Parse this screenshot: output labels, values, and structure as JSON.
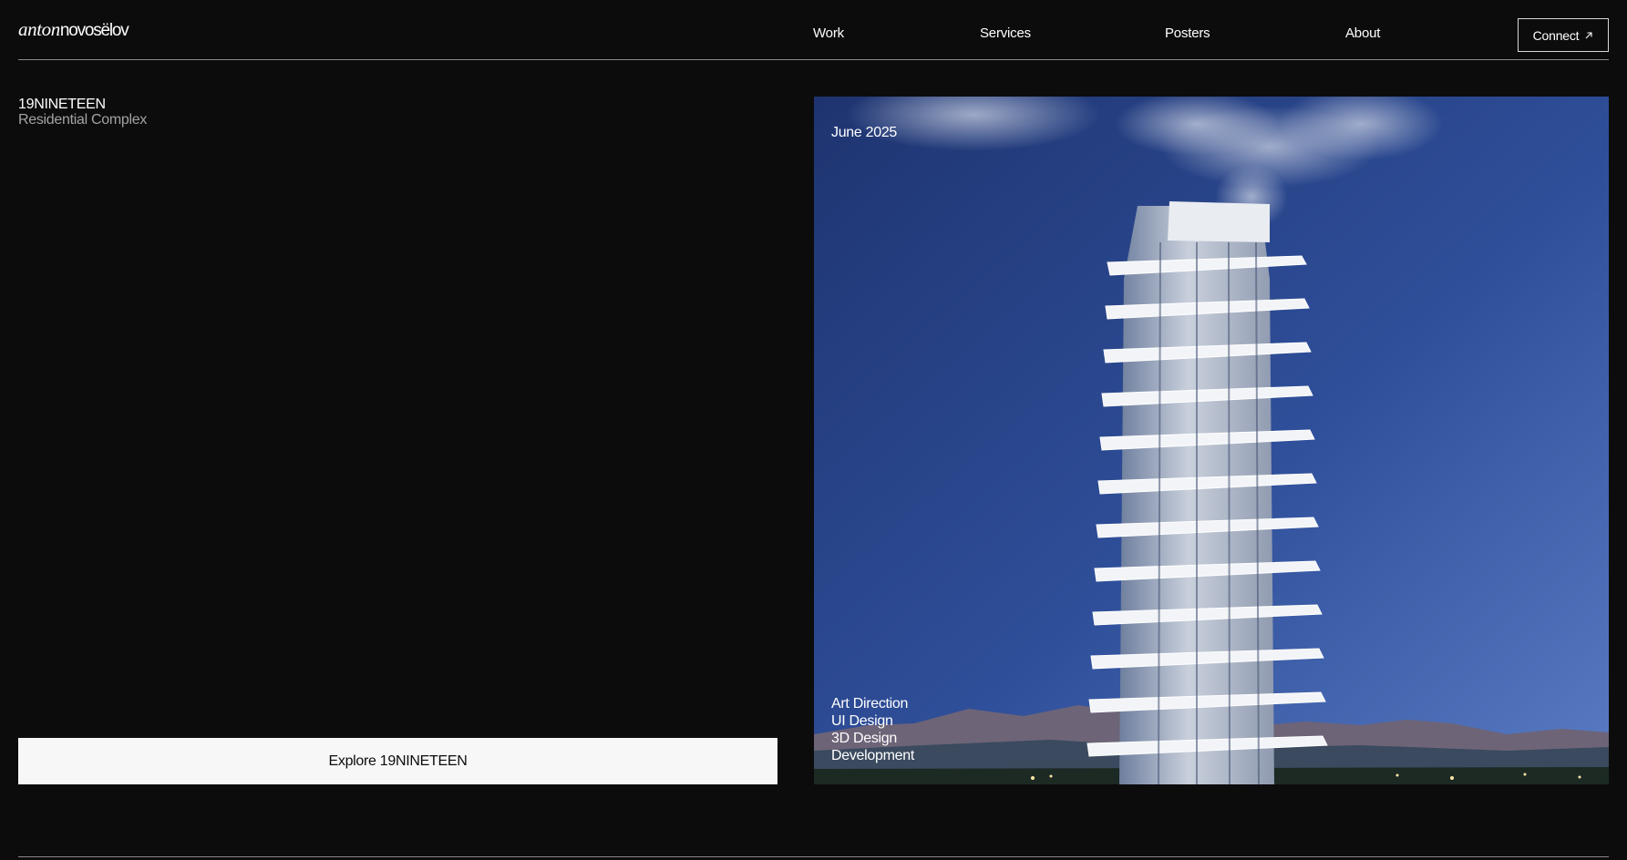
{
  "brand": {
    "logo_first": "anton",
    "logo_last": "novosëlov"
  },
  "nav": {
    "items": [
      {
        "label": "Work"
      },
      {
        "label": "Services"
      },
      {
        "label": "Posters"
      },
      {
        "label": "About"
      }
    ],
    "connect_label": "Connect",
    "connect_icon": "arrow-up-right-icon"
  },
  "project": {
    "title": "19NINETEEN",
    "subtitle": "Residential Complex",
    "cta_label": "Explore 19NINETEEN",
    "date": "June 2025",
    "tags": [
      "Art Direction",
      "UI Design",
      "3D Design",
      "Development"
    ]
  },
  "colors": {
    "background": "#0c0c0d",
    "text": "#ffffff",
    "muted_text": "#a3a3a3",
    "button_bg": "#f7f7f7",
    "sky_top": "#1e3470",
    "sky_bottom": "#5a7cc4"
  }
}
